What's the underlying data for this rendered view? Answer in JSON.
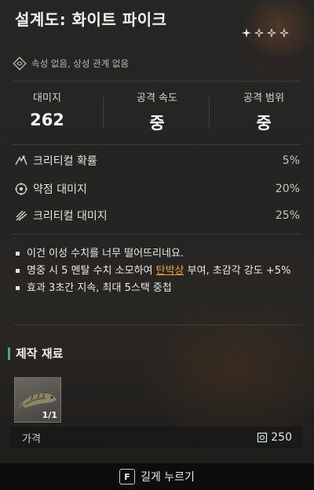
{
  "title": "설계도: 화이트 파이크",
  "rarity_stars": [
    {
      "icon": "filled-star-icon"
    },
    {
      "icon": "empty-star-icon"
    },
    {
      "icon": "empty-star-icon"
    },
    {
      "icon": "empty-star-icon"
    }
  ],
  "attribute": {
    "icon": "attribute-icon",
    "text": "속성 없음, 상성 관계 없음"
  },
  "stats": [
    {
      "label": "대미지",
      "value": "262"
    },
    {
      "label": "공격 속도",
      "value": "중"
    },
    {
      "label": "공격 범위",
      "value": "중"
    }
  ],
  "sub_stats": [
    {
      "icon": "critical-rate-icon",
      "label": "크리티컬 확률",
      "value": "5%"
    },
    {
      "icon": "weakpoint-icon",
      "label": "약점 대미지",
      "value": "20%"
    },
    {
      "icon": "critical-damage-icon",
      "label": "크리티컬 대미지",
      "value": "25%"
    }
  ],
  "description": {
    "line1": "이건 이성 수치를 너무 떨어뜨리네요.",
    "line2_before": "명중 시 5 멘탈 수치 소모하여 ",
    "line2_highlight": "탄박상",
    "line2_after": " 부여, 초감각 강도 +5%",
    "line3": "효과 3초간 지속, 최대 5스택 중첩"
  },
  "materials": {
    "title": "제작 재료",
    "items": [
      {
        "icon": "fish-icon",
        "count": "1/1"
      }
    ]
  },
  "price": {
    "label": "가격",
    "icon": "currency-icon",
    "value": "250"
  },
  "footer": {
    "key": "F",
    "hint": "길게 누르기"
  },
  "colors": {
    "accent_green": "#3fae86",
    "highlight_orange": "#e8a23a"
  }
}
